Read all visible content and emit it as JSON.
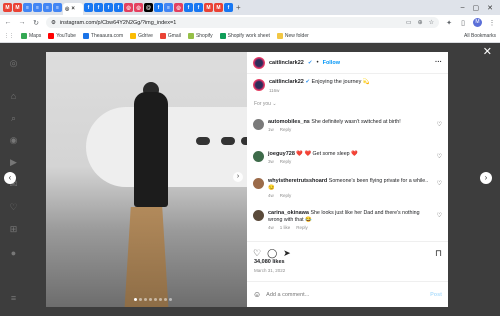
{
  "browser": {
    "url": "instagram.com/p/Cbw64Y2N2Gg/?img_index=1",
    "tab_close": "×",
    "new_tab": "+",
    "bookmarks": [
      {
        "label": "Maps",
        "color": "#34a853"
      },
      {
        "label": "YouTube",
        "color": "#ff0000"
      },
      {
        "label": "Theaaura.com",
        "color": "#1a73e8"
      },
      {
        "label": "Gdrive",
        "color": "#fbbc04"
      },
      {
        "label": "Gmail",
        "color": "#ea4335"
      },
      {
        "label": "Shopify",
        "color": "#95bf47"
      },
      {
        "label": "Shopify work sheet",
        "color": "#0f9d58"
      },
      {
        "label": "New folder",
        "color": "#f2c744"
      }
    ],
    "all_bookmarks": "All Bookmarks",
    "profile_initial": "M"
  },
  "post": {
    "username": "caitlinclark22",
    "follow_label": "Follow",
    "more_icon": "more-icon",
    "caption": "Enjoying the journey 💫",
    "caption_age": "116w",
    "for_you_label": "For you",
    "comments": [
      {
        "user": "automobiles_ns",
        "text": "She definitely wasn't switched at birth!",
        "age": "1w",
        "reply": "Reply",
        "avatar_color": "#7a7a7a"
      },
      {
        "user": "joeguy728",
        "text": "❤️ ❤️ Get some sleep ❤️",
        "age": "3w",
        "reply": "Reply",
        "avatar_color": "#3e6b4a"
      },
      {
        "user": "whyistheretrutsshoard",
        "text": "Someone's been flying private for a while.. 😏",
        "age": "4w",
        "reply": "Reply",
        "avatar_color": "#9b6b4a"
      },
      {
        "user": "carina_okinawa",
        "text": "She looks just like her Dad and there's nothing wrong with that 😂",
        "age": "4w",
        "reply": "Reply",
        "likes": "1 like",
        "avatar_color": "#5a4a3a"
      }
    ],
    "likes": "34,080 likes",
    "date": "March 31, 2022",
    "add_comment_placeholder": "Add a comment...",
    "post_label": "Post",
    "photo_dots": 8
  },
  "colors": {
    "accent": "#0095f6",
    "verified": "#3897f0"
  }
}
